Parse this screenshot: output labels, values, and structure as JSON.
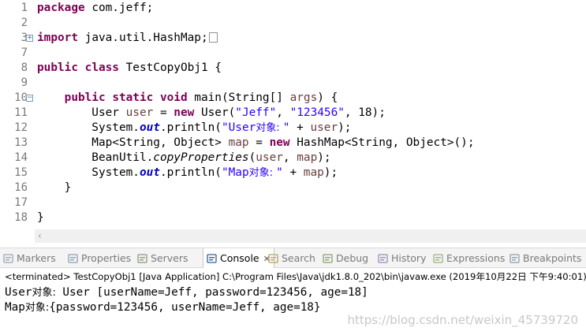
{
  "editor": {
    "lines": [
      {
        "n": "1",
        "fold": "",
        "code": [
          [
            "kw",
            "package"
          ],
          [
            "",
            "com.jeff;"
          ]
        ]
      },
      {
        "n": "2",
        "fold": "",
        "code": []
      },
      {
        "n": "3",
        "fold": "+",
        "code": [
          [
            "kw",
            "import"
          ],
          [
            "",
            "java.util.HashMap;"
          ],
          [
            "box",
            ""
          ]
        ]
      },
      {
        "n": "7",
        "fold": "",
        "code": []
      },
      {
        "n": "8",
        "fold": "",
        "code": [
          [
            "kw",
            "public"
          ],
          [
            "",
            "&sp"
          ],
          [
            "kw",
            "class"
          ],
          [
            "",
            "TestCopyObj1 {"
          ]
        ]
      },
      {
        "n": "9",
        "fold": "",
        "code": []
      },
      {
        "n": "10",
        "fold": "-",
        "code": [
          [
            "",
            "    "
          ],
          [
            "kw",
            "public"
          ],
          [
            "",
            "&sp"
          ],
          [
            "kw",
            "static"
          ],
          [
            "",
            "&sp"
          ],
          [
            "kw",
            "void"
          ],
          [
            "",
            "main(String[] "
          ],
          [
            "var",
            "args"
          ],
          [
            "",
            ") {"
          ]
        ]
      },
      {
        "n": "11",
        "fold": "",
        "code": [
          [
            "",
            "        User "
          ],
          [
            "var",
            "user"
          ],
          [
            "",
            " = "
          ],
          [
            "kw",
            "new"
          ],
          [
            "",
            "User("
          ],
          [
            "str",
            "\"Jeff\""
          ],
          [
            "",
            ", "
          ],
          [
            "str",
            "\"123456\""
          ],
          [
            "",
            ", 18);"
          ]
        ]
      },
      {
        "n": "12",
        "fold": "",
        "code": [
          [
            "",
            "        System."
          ],
          [
            "fld",
            "out"
          ],
          [
            "",
            ".println("
          ],
          [
            "str",
            "\"User"
          ],
          [
            "cjkstr",
            "对象: "
          ],
          [
            "str",
            "\""
          ],
          [
            "",
            " + "
          ],
          [
            "var",
            "user"
          ],
          [
            "",
            ");"
          ]
        ]
      },
      {
        "n": "13",
        "fold": "",
        "code": [
          [
            "",
            "        Map<String, Object> "
          ],
          [
            "var",
            "map"
          ],
          [
            "",
            " = "
          ],
          [
            "kw",
            "new"
          ],
          [
            "",
            "HashMap<String, Object>();"
          ]
        ]
      },
      {
        "n": "14",
        "fold": "",
        "code": [
          [
            "",
            "        BeanUtil."
          ],
          [
            "sm",
            "copyProperties"
          ],
          [
            "",
            "("
          ],
          [
            "var",
            "user"
          ],
          [
            "",
            ", "
          ],
          [
            "var",
            "map"
          ],
          [
            "",
            ");"
          ]
        ]
      },
      {
        "n": "15",
        "fold": "",
        "code": [
          [
            "",
            "        System."
          ],
          [
            "fld",
            "out"
          ],
          [
            "",
            ".println("
          ],
          [
            "str",
            "\"Map"
          ],
          [
            "cjkstr",
            "对象: "
          ],
          [
            "str",
            "\""
          ],
          [
            "",
            " + "
          ],
          [
            "var",
            "map"
          ],
          [
            "",
            ");"
          ]
        ]
      },
      {
        "n": "16",
        "fold": "",
        "code": [
          [
            "",
            "    }"
          ]
        ]
      },
      {
        "n": "17",
        "fold": "",
        "code": []
      },
      {
        "n": "18",
        "fold": "",
        "code": [
          [
            "",
            "}"
          ]
        ]
      }
    ]
  },
  "tabs": [
    {
      "name": "tab-markers",
      "label": "Markers",
      "icon": "markers-icon",
      "color": "#9aa7b8",
      "active": false
    },
    {
      "name": "tab-properties",
      "label": "Properties",
      "icon": "properties-icon",
      "color": "#8aa0b8",
      "active": false
    },
    {
      "name": "tab-servers",
      "label": "Servers",
      "icon": "servers-icon",
      "color": "#8c9a7c",
      "active": false
    },
    {
      "name": "tab-console",
      "label": "Console",
      "icon": "console-icon",
      "color": "#3a5f8f",
      "active": true,
      "close": "✕"
    },
    {
      "name": "tab-search",
      "label": "Search",
      "icon": "search-icon",
      "color": "#b8a060",
      "active": false
    },
    {
      "name": "tab-debug",
      "label": "Debug",
      "icon": "debug-icon",
      "color": "#8aa070",
      "active": false
    },
    {
      "name": "tab-history",
      "label": "History",
      "icon": "history-icon",
      "color": "#9a8cb8",
      "active": false
    },
    {
      "name": "tab-expressions",
      "label": "Expressions",
      "icon": "expressions-icon",
      "color": "#a0b080",
      "active": false
    },
    {
      "name": "tab-breakpoints",
      "label": "Breakpoints",
      "icon": "breakpoints-icon",
      "color": "#8ca0b0",
      "active": false
    }
  ],
  "console": {
    "header": "<terminated> TestCopyObj1 [Java Application] C:\\Program Files\\Java\\jdk1.8.0_202\\bin\\javaw.exe (2019年10月22日 下午9:40:01)",
    "output": [
      {
        "prefix": "User",
        "cjk": "对象:",
        "rest": " User [userName=Jeff, password=123456, age=18]"
      },
      {
        "prefix": "Map",
        "cjk": "对象:",
        "rest": "{password=123456, userName=Jeff, age=18}"
      }
    ]
  },
  "watermark": "https://blog.csdn.net/weixin_45739720",
  "colors": {
    "keyword": "#7f0055",
    "string": "#2a00ff",
    "local_variable": "#6a3e3e",
    "field": "#0000c0"
  }
}
